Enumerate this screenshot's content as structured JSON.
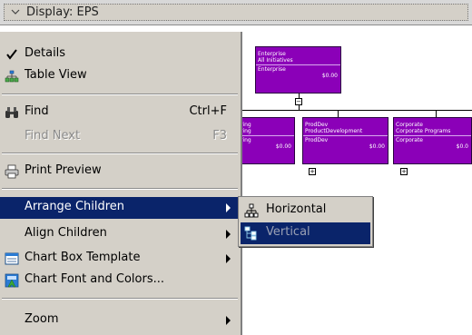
{
  "display_bar": {
    "label": "Display: EPS"
  },
  "menu": {
    "items": [
      {
        "label": "Details",
        "icon": "checkmark-icon",
        "checked": true
      },
      {
        "label": "Table View",
        "icon": "table-view-icon"
      },
      {
        "label": "Find",
        "shortcut": "Ctrl+F",
        "icon": "binoculars-icon"
      },
      {
        "label": "Find Next",
        "shortcut": "F3",
        "disabled": true
      },
      {
        "label": "Print Preview",
        "icon": "printer-icon"
      },
      {
        "label": "Arrange Children",
        "has_submenu": true,
        "highlighted": true
      },
      {
        "label": "Align Children",
        "has_submenu": true
      },
      {
        "label": "Chart Box Template",
        "icon": "chart-box-template-icon",
        "has_submenu": true
      },
      {
        "label": "Chart Font and Colors...",
        "icon": "chart-font-colors-icon"
      },
      {
        "label": "Zoom",
        "has_submenu": true
      }
    ]
  },
  "submenu": {
    "items": [
      {
        "label": "Horizontal",
        "icon": "horizontal-arrange-icon"
      },
      {
        "label": "Vertical",
        "icon": "vertical-arrange-icon",
        "highlighted": true,
        "disabled": true
      }
    ]
  },
  "chart": {
    "root": {
      "line1": "Enterprise",
      "line2": "All Initiatives",
      "line3": "Enterprise",
      "amount": "$0.00"
    },
    "partial": {
      "line1": "ring",
      "line2": "ring",
      "line3": "ring",
      "amount": "$0.00"
    },
    "prod": {
      "line1": "ProdDev",
      "line2": "ProductDevelopment",
      "line3": "ProdDev",
      "amount": "$0.00"
    },
    "corp": {
      "line1": "Corporate",
      "line2": "Corporate Programs",
      "line3": "Corporate",
      "amount": "$0.0"
    },
    "expander_collapsed": "−",
    "expander_expanded": "+"
  },
  "colors": {
    "chart_box": "#8b00b8",
    "menu_bg": "#d4d0c8",
    "highlight": "#0a246a"
  }
}
